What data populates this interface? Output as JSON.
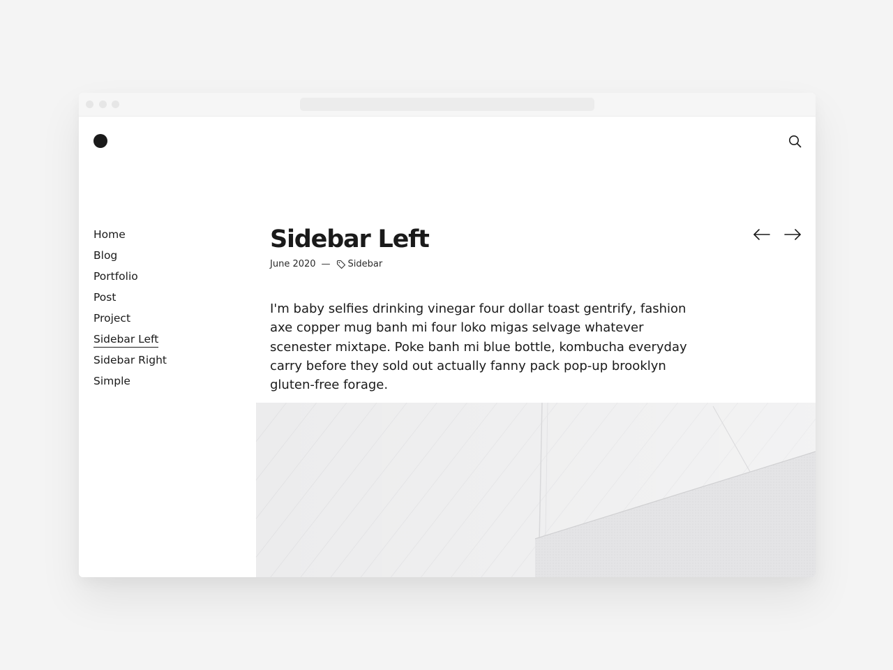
{
  "site": {
    "logo_icon": "logo-dot-icon",
    "search_icon": "search-icon"
  },
  "nav": {
    "items": [
      {
        "label": "Home",
        "active": false
      },
      {
        "label": "Blog",
        "active": false
      },
      {
        "label": "Portfolio",
        "active": false
      },
      {
        "label": "Post",
        "active": false
      },
      {
        "label": "Project",
        "active": false
      },
      {
        "label": "Sidebar Left",
        "active": true
      },
      {
        "label": "Sidebar Right",
        "active": false
      },
      {
        "label": "Simple",
        "active": false
      }
    ]
  },
  "post": {
    "title": "Sidebar Left",
    "date": "June 2020",
    "separator": "—",
    "tag": "Sidebar",
    "tag_icon": "tag-icon",
    "body": "I'm baby selfies drinking vinegar four dollar toast gentrify, fashion axe copper mug banh mi four loko migas selvage whatever scenester mixtape. Poke banh mi blue bottle, kombucha everyday carry before they sold out actually fanny pack pop-up brooklyn gluten-free forage.",
    "prev_icon": "arrow-left-icon",
    "next_icon": "arrow-right-icon"
  },
  "colors": {
    "text": "#1a1a1a",
    "background": "#ffffff",
    "page_background": "#f4f4f4"
  }
}
